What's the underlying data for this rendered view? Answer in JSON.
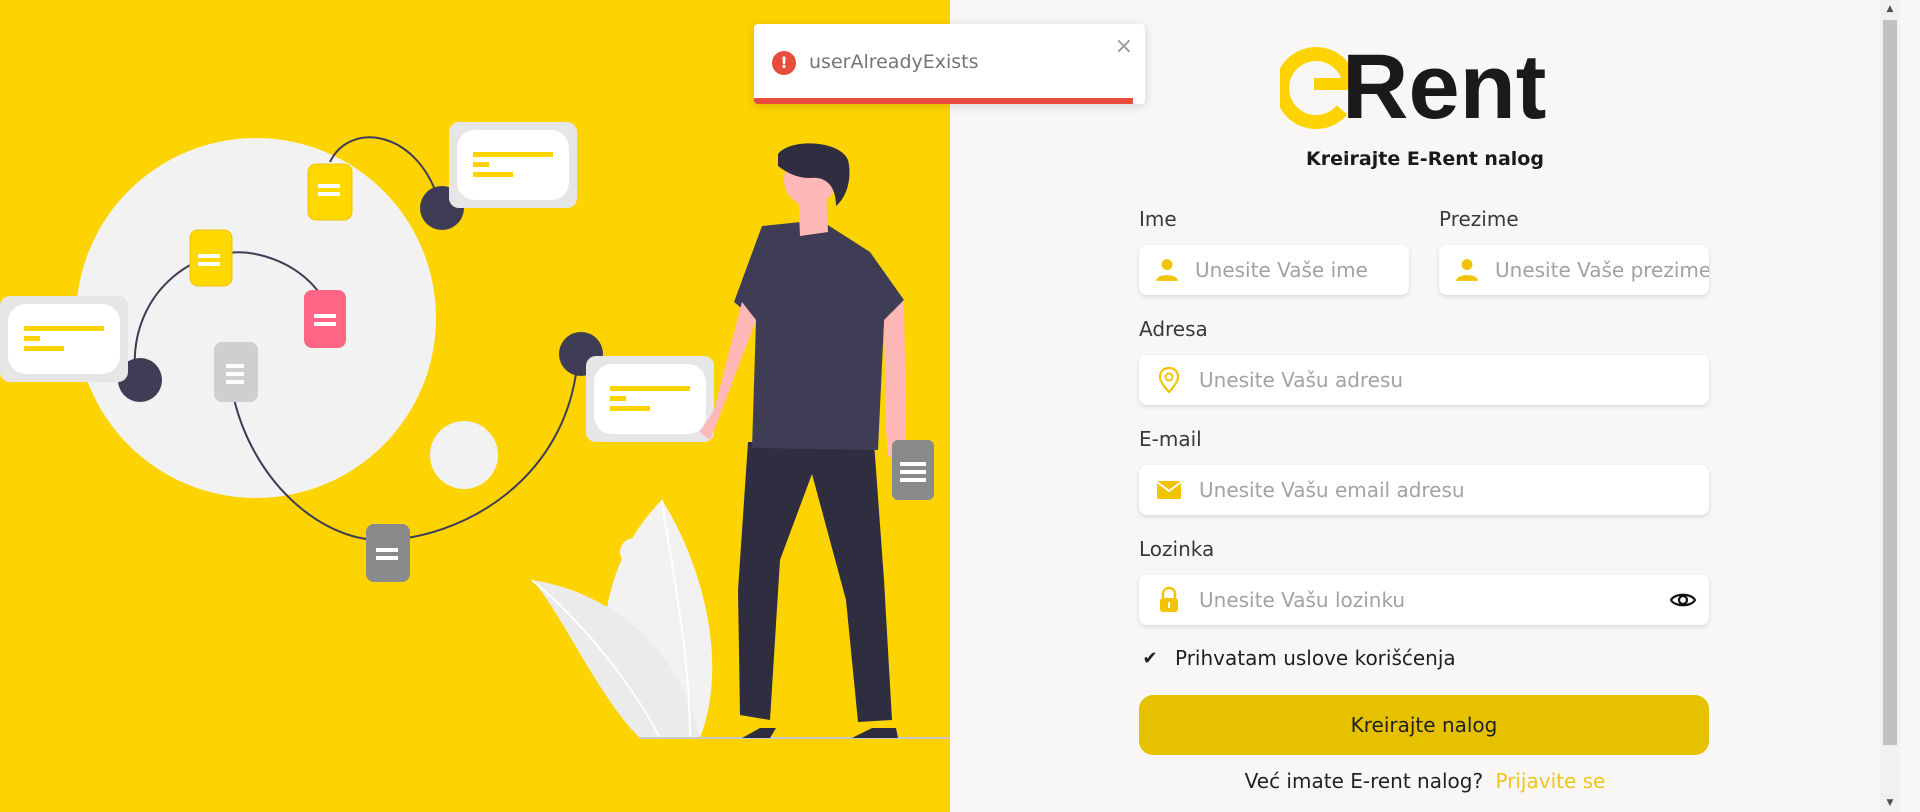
{
  "brand": {
    "logo_prefix": "e",
    "logo_suffix": "Rent",
    "accent": "#fdd402"
  },
  "form": {
    "subtitle": "Kreirajte E-Rent nalog",
    "first_name": {
      "label": "Ime",
      "placeholder": "Unesite Vaše ime",
      "icon": "user-icon"
    },
    "last_name": {
      "label": "Prezime",
      "placeholder": "Unesite Vaše prezime",
      "icon": "user-icon"
    },
    "address": {
      "label": "Adresa",
      "placeholder": "Unesite Vašu adresu",
      "icon": "map-pin-icon"
    },
    "email": {
      "label": "E-mail",
      "placeholder": "Unesite Vašu email adresu",
      "icon": "envelope-icon"
    },
    "password": {
      "label": "Lozinka",
      "placeholder": "Unesite Vašu lozinku",
      "icon": "lock-icon",
      "toggle_icon": "eye-icon"
    },
    "terms": {
      "checkmark": "✔",
      "label": "Prihvatam uslove korišćenja",
      "checked": true
    },
    "submit_label": "Kreirajte nalog",
    "footer": {
      "prompt": "Već imate E-rent nalog?",
      "link": "Prijavite se"
    }
  },
  "toast": {
    "icon": "!",
    "message": "userAlreadyExists",
    "close": "×",
    "type": "error",
    "progress": 0.97
  },
  "scrollbar": {
    "up": "▲",
    "down": "▼"
  },
  "colors": {
    "primary_yellow": "#fdd402",
    "button": "#e6c100",
    "link": "#f0c419",
    "error": "#e74c3c",
    "dark": "#3f3d56",
    "pink": "#ff6584"
  }
}
